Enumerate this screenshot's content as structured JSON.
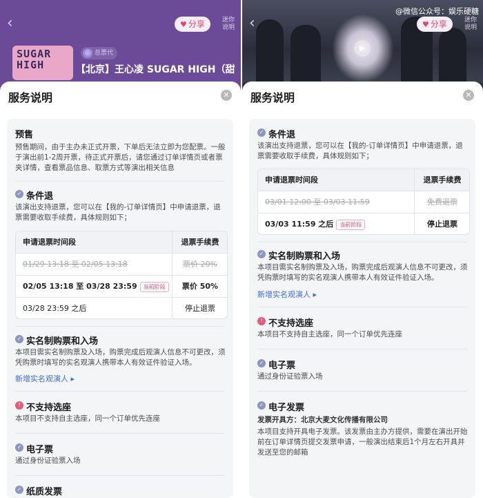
{
  "left": {
    "share_label": "分享",
    "service_note": "迷你说明",
    "poster_text": "SUGAR HIGH",
    "agent_label": "总票代",
    "event_title": "【北京】王心凌 SUGAR HIGH（甜",
    "sheet": {
      "title": "服务说明",
      "presale": {
        "title": "预售",
        "text": "预售期间，由于主办未正式开票，下单后无法立即为您配票。一般于演出前1-2周开票，待正式开票后，请您通过订单详情页或者票夹详情，查看票品信息、取票方式等演出相关信息"
      },
      "refund": {
        "title": "条件退",
        "text": "该演出支持退票，您可以在【我的-订单详情页】中申请退票，退票需要收取手续费，具体规则如下；",
        "table": {
          "headers": [
            "申请退票时间段",
            "退票手续费"
          ],
          "rows": [
            {
              "period": "01/29 13:18 至 02/05 13:18",
              "fee": "票价 20%",
              "past": true,
              "current": false
            },
            {
              "period": "02/05 13:18 至 03/28 23:59",
              "fee": "票价 50%",
              "past": false,
              "current": true
            },
            {
              "period": "03/28 23:59 之后",
              "fee": "停止退票",
              "past": false,
              "current": false
            }
          ],
          "current_tag": "当前阶段"
        }
      },
      "realname": {
        "title": "实名制购票和入场",
        "text": "本项目需实名制购票及入场，购票完成后观演人信息不可更改，须凭购票时填写的实名观演人携带本人有效证件验证入场。",
        "link": "新增实名观演人 ▸"
      },
      "no_seat": {
        "title": "不支持选座",
        "text": "本项目不支持自主选座，同一个订单优先连座"
      },
      "eticket": {
        "title": "电子票",
        "text": "通过身份证验票入场"
      },
      "paper_invoice": {
        "title": "纸质发票"
      }
    }
  },
  "right": {
    "watermark": "@微信公众号：娱乐硬糖",
    "share_label": "分享",
    "service_note": "迷你说明",
    "sheet": {
      "title": "服务说明",
      "refund": {
        "title": "条件退",
        "text": "该演出支持退票，您可以在【我的-订单详情页】中申请退票，退票需要收取手续费，具体规则如下；",
        "table": {
          "headers": [
            "申请退票时间段",
            "退票手续费"
          ],
          "rows": [
            {
              "period": "03/01 12:00 至 03/03 11:59",
              "fee": "免费退票",
              "past": true,
              "current": false
            },
            {
              "period": "03/03 11:59 之后",
              "fee": "停止退票",
              "past": false,
              "current": true
            }
          ],
          "current_tag": "当前阶段"
        }
      },
      "realname": {
        "title": "实名制购票和入场",
        "text": "本项目需实名制购票及入场，购票完成后观演人信息不可更改，须凭购票时填写的实名观演人携带本人有效证件验证入场。",
        "link": "新增实名观演人 ▸"
      },
      "no_seat": {
        "title": "不支持选座",
        "text": "本项目不支持自主选座，同一个订单优先连座"
      },
      "eticket": {
        "title": "电子票",
        "text": "通过身份证验票入场"
      },
      "e_invoice": {
        "title": "电子发票",
        "issuer": "发票开具方：北京大麦文化传播有限公司",
        "text": "本项目支持开具电子发票。该发票由主办方提供，需要在演出开始前在订单详情页提交发票申请，一般演出结束后1个月左右开具并发送至您的邮箱"
      }
    }
  },
  "colors": {
    "accent": "#e0466a",
    "link": "#3c6ce0",
    "check_icon": "#8b96c4",
    "warn_icon": "#e85a7a"
  }
}
